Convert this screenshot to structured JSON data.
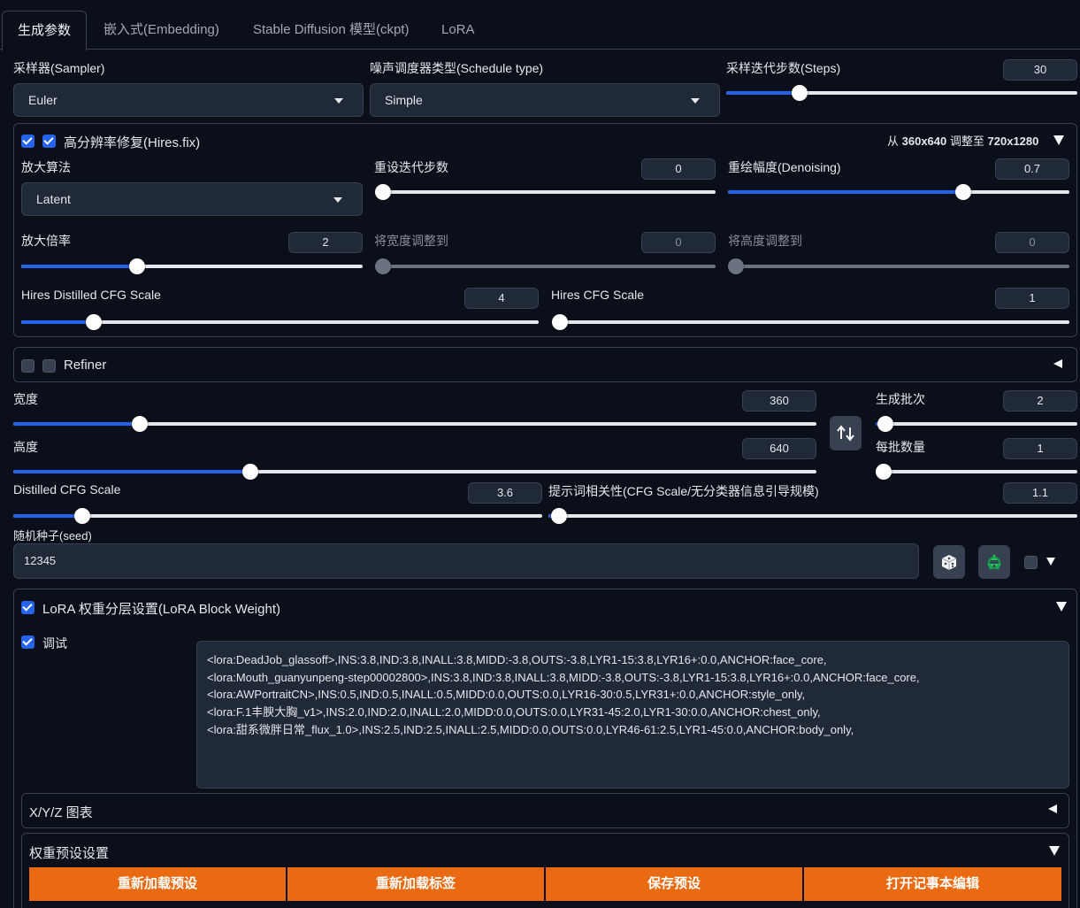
{
  "tabs": [
    "生成参数",
    "嵌入式(Embedding)",
    "Stable Diffusion 模型(ckpt)",
    "LoRA"
  ],
  "sampler": {
    "label": "采样器(Sampler)",
    "value": "Euler"
  },
  "schedule": {
    "label": "噪声调度器类型(Schedule type)",
    "value": "Simple"
  },
  "steps": {
    "label": "采样迭代步数(Steps)",
    "value": "30",
    "fraction": 0.21
  },
  "hires": {
    "title": "高分辨率修复(Hires.fix)",
    "resize_info_prefix": "从",
    "resize_from": "360x640",
    "resize_mid": "调整至",
    "resize_to": "720x1280",
    "upscaler": {
      "label": "放大算法",
      "value": "Latent"
    },
    "steps": {
      "label": "重设迭代步数",
      "value": "0",
      "fraction": 0.0
    },
    "denoising": {
      "label": "重绘幅度(Denoising)",
      "value": "0.7",
      "fraction": 0.69
    },
    "scale": {
      "label": "放大倍率",
      "value": "2",
      "fraction": 0.34
    },
    "resize_w": {
      "label": "将宽度调整到",
      "value": "0",
      "fraction": 0.0
    },
    "resize_h": {
      "label": "将高度调整到",
      "value": "0",
      "fraction": 0.0
    },
    "distilled_cfg": {
      "label": "Hires Distilled CFG Scale",
      "value": "4",
      "fraction": 0.14
    },
    "cfg": {
      "label": "Hires CFG Scale",
      "value": "1",
      "fraction": 0.0
    }
  },
  "refiner": {
    "label": "Refiner"
  },
  "width": {
    "label": "宽度",
    "value": "360",
    "fraction": 0.158
  },
  "height": {
    "label": "高度",
    "value": "640",
    "fraction": 0.295
  },
  "batch_count": {
    "label": "生成批次",
    "value": "2",
    "fraction": 0.05
  },
  "batch_size": {
    "label": "每批数量",
    "value": "1",
    "fraction": 0.0
  },
  "distilled_cfg": {
    "label": "Distilled CFG Scale",
    "value": "3.6",
    "fraction": 0.13
  },
  "cfg": {
    "label": "提示词相关性(CFG Scale/无分类器信息引导规模)",
    "value": "1.1",
    "fraction": 0.02
  },
  "seed": {
    "label": "随机种子(seed)",
    "value": "12345"
  },
  "lbw": {
    "title": "LoRA 权重分层设置(LoRA Block Weight)",
    "debug_label": "调试",
    "text": "<lora:DeadJob_glassoff>,INS:3.8,IND:3.8,INALL:3.8,MIDD:-3.8,OUTS:-3.8,LYR1-15:3.8,LYR16+:0.0,ANCHOR:face_core,\n<lora:Mouth_guanyunpeng-step00002800>,INS:3.8,IND:3.8,INALL:3.8,MIDD:-3.8,OUTS:-3.8,LYR1-15:3.8,LYR16+:0.0,ANCHOR:face_core,\n<lora:AWPortraitCN>,INS:0.5,IND:0.5,INALL:0.5,MIDD:0.0,OUTS:0.0,LYR16-30:0.5,LYR31+:0.0,ANCHOR:style_only,\n<lora:F.1丰腴大胸_v1>,INS:2.0,IND:2.0,INALL:2.0,MIDD:0.0,OUTS:0.0,LYR31-45:2.0,LYR1-30:0.0,ANCHOR:chest_only,\n<lora:甜系微胖日常_flux_1.0>,INS:2.5,IND:2.5,INALL:2.5,MIDD:0.0,OUTS:0.0,LYR46-61:2.5,LYR1-45:0.0,ANCHOR:body_only,",
    "xyz_label": "X/Y/Z 图表",
    "preset_label": "权重预设设置",
    "buttons": [
      "重新加载预设",
      "重新加载标签",
      "保存预设",
      "打开记事本编辑"
    ]
  },
  "colors": {
    "accent": "#2563eb",
    "orange": "#ea6a12",
    "background": "#0b0f19"
  }
}
